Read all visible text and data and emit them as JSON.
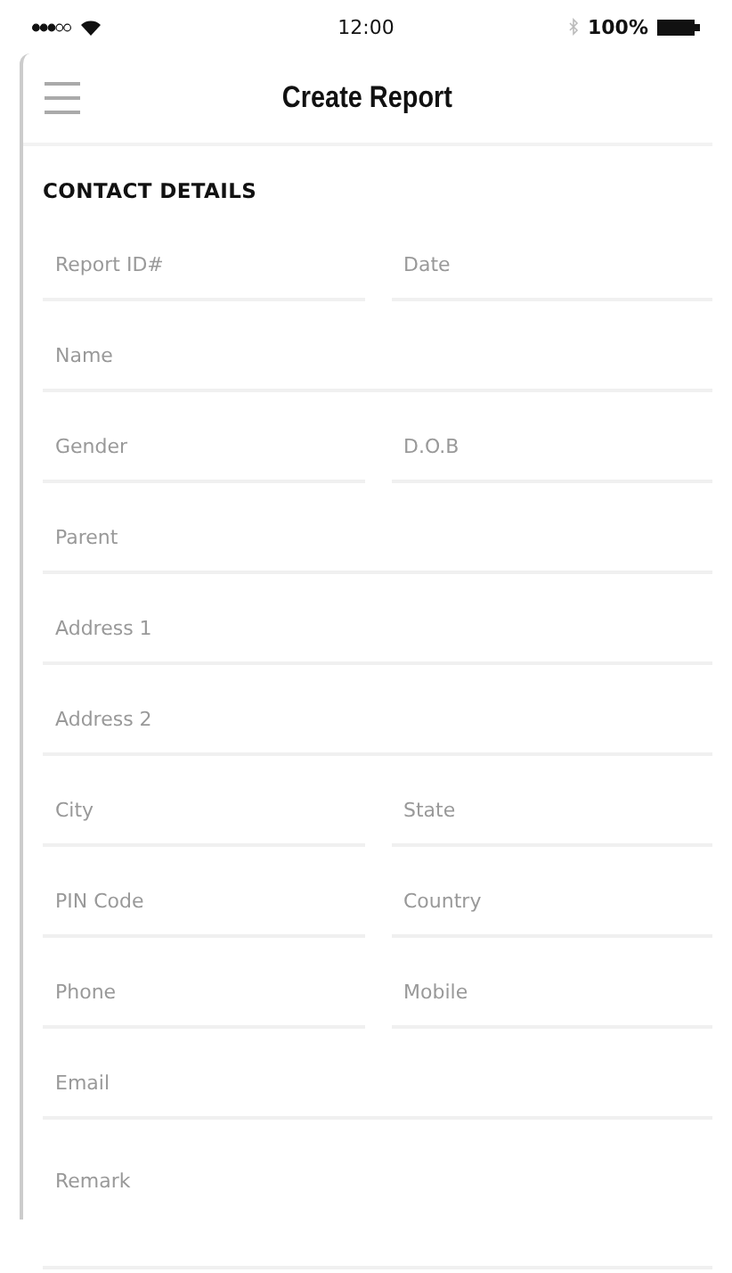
{
  "status_bar": {
    "time": "12:00",
    "battery": "100%"
  },
  "header": {
    "title": "Create Report"
  },
  "section": {
    "title": "CONTACT DETAILS"
  },
  "rows": [
    {
      "fields": [
        {
          "placeholder": "Report ID#"
        },
        {
          "placeholder": "Date"
        }
      ]
    },
    {
      "fields": [
        {
          "placeholder": "Name"
        }
      ]
    },
    {
      "fields": [
        {
          "placeholder": "Gender"
        },
        {
          "placeholder": "D.O.B"
        }
      ]
    },
    {
      "fields": [
        {
          "placeholder": "Parent"
        }
      ]
    },
    {
      "fields": [
        {
          "placeholder": "Address 1"
        }
      ]
    },
    {
      "fields": [
        {
          "placeholder": "Address 2"
        }
      ]
    },
    {
      "fields": [
        {
          "placeholder": "City"
        },
        {
          "placeholder": "State"
        }
      ]
    },
    {
      "fields": [
        {
          "placeholder": "PIN Code"
        },
        {
          "placeholder": "Country"
        }
      ]
    },
    {
      "fields": [
        {
          "placeholder": "Phone"
        },
        {
          "placeholder": "Mobile"
        }
      ]
    },
    {
      "fields": [
        {
          "placeholder": "Email"
        }
      ]
    }
  ],
  "remark": {
    "placeholder": "Remark"
  }
}
